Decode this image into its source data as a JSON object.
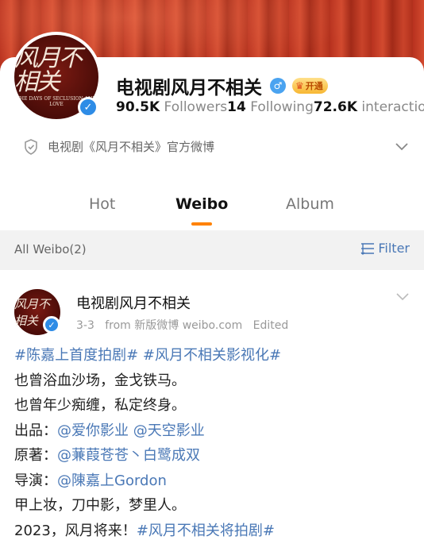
{
  "profile": {
    "name": "电视剧风月不相关",
    "avatar_text_cn": "风月不相关",
    "avatar_text_en": "THE DAYS OF SECLUSION AND LOVE",
    "vip_label": "开通",
    "followers_count": "90.5K",
    "followers_label": "Followers",
    "following_count": "14",
    "following_label": "Following",
    "interactions_count": "72.6K",
    "interactions_label": "interactio",
    "verified_description": "电视剧《风月不相关》官方微博"
  },
  "tabs": [
    {
      "label": "Hot"
    },
    {
      "label": "Weibo"
    },
    {
      "label": "Album"
    }
  ],
  "filter_bar": {
    "all_label": "All Weibo(2)",
    "filter_label": "Filter"
  },
  "post": {
    "author": "电视剧风月不相关",
    "date": "3-3",
    "source": "from 新版微博 weibo.com",
    "edited": "Edited",
    "line1_tag1": "#陈嘉上首度拍剧#",
    "line1_tag2": "#风月不相关影视化#",
    "line2": "也曾浴血沙场，金戈铁马。",
    "line3": "也曾年少痴缠，私定终身。",
    "line4_prefix": "出品：",
    "line4_mention1": "@爱你影业",
    "line4_mention2": "@天空影业",
    "line5_prefix": "原著：",
    "line5_mention": "@蒹葭苍苍丶白鹭成双",
    "line6_prefix": "导演：",
    "line6_mention": "@陳嘉上Gordon",
    "line7": "甲上妆，刀中影，梦里人。",
    "line8_prefix": "2023，风月将来！",
    "line8_tag": "#风月不相关将拍剧#"
  },
  "colors": {
    "accent": "#ff8200",
    "link": "#4a78b6",
    "verify": "#2e8ce6"
  }
}
